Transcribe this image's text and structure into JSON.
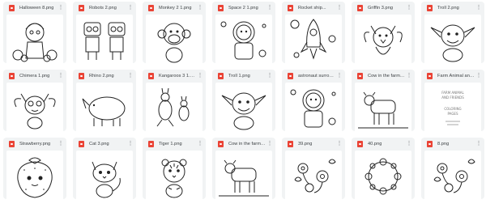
{
  "files": [
    {
      "name": "Halloween 8.png",
      "thumb": "halloween-kids-drawing"
    },
    {
      "name": "Robots 2.png",
      "thumb": "robots-drawing"
    },
    {
      "name": "Monkey 2 1.png",
      "thumb": "monkey-drawing"
    },
    {
      "name": "Space 2 1.png",
      "thumb": "astronaut-drawing"
    },
    {
      "name": "Rocket ship...",
      "thumb": "rocket-drawing"
    },
    {
      "name": "Griffin 3.png",
      "thumb": "griffin-drawing"
    },
    {
      "name": "Troll 2.png",
      "thumb": "troll-drawing"
    },
    {
      "name": "Chimera 1.png",
      "thumb": "chimera-drawing"
    },
    {
      "name": "Rhino 2.png",
      "thumb": "rhino-drawing"
    },
    {
      "name": "Kangaroos 3 1.png",
      "thumb": "kangaroos-drawing"
    },
    {
      "name": "Troll 1.png",
      "thumb": "troll-drawing"
    },
    {
      "name": "astronaut surrounde...",
      "thumb": "astronaut-drawing"
    },
    {
      "name": "Cow in the farm 2.png",
      "thumb": "cow-drawing"
    },
    {
      "name": "Farm Animal and...",
      "thumb": "title-page"
    },
    {
      "name": "Strawberry.png",
      "thumb": "strawberry-drawing"
    },
    {
      "name": "Cat 3.png",
      "thumb": "cat-drawing"
    },
    {
      "name": "Tiger 1.png",
      "thumb": "tiger-drawing"
    },
    {
      "name": "Cow in the farm 1.png",
      "thumb": "cow-drawing"
    },
    {
      "name": "39.png",
      "thumb": "flowers-drawing"
    },
    {
      "name": "40.png",
      "thumb": "flower-wreath-drawing"
    },
    {
      "name": "8.png",
      "thumb": "flowers-drawing"
    }
  ],
  "title_page_text": [
    "FARM ANIMAL",
    "AND FRIENDS",
    "COLORING",
    "PAGES"
  ],
  "icons": {
    "file": "image-file-icon",
    "more": "more-options-icon"
  },
  "colors": {
    "file_icon": "#ea4335",
    "tile_bg": "#f1f3f4",
    "text": "#3c4043"
  }
}
